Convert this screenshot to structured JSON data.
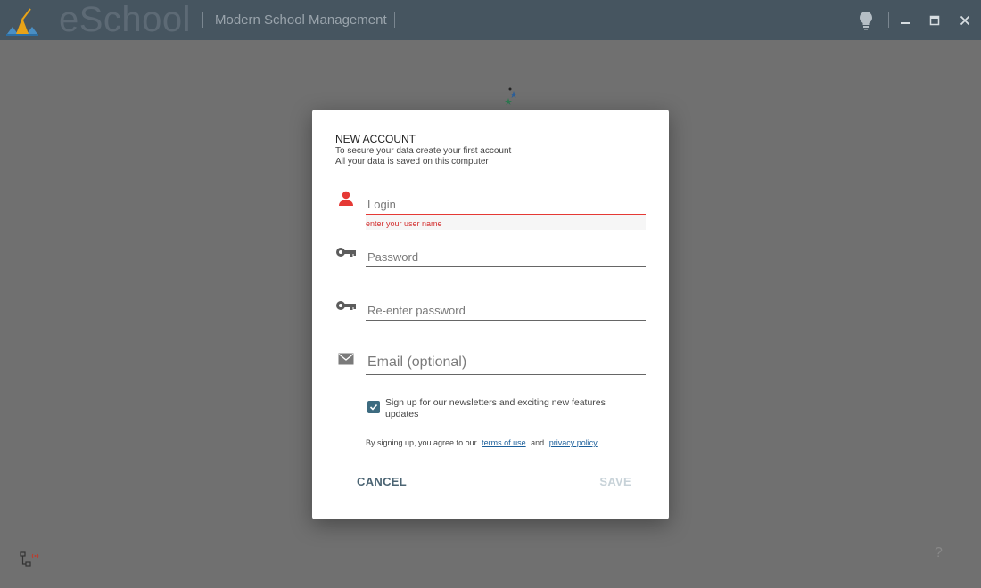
{
  "window": {
    "brand": "eSchool",
    "subtitle": "Modern School Management",
    "icons": [
      "app-logo-icon",
      "lightbulb-icon",
      "minimize-icon",
      "maximize-icon",
      "close-icon"
    ]
  },
  "dialog": {
    "title": "NEW ACCOUNT",
    "desc_line1": "To secure your data create your first account",
    "desc_line2": "All your data is saved on this computer",
    "fields": {
      "login": {
        "placeholder": "Login",
        "value": "",
        "error": "enter your user name",
        "icon": "person-icon"
      },
      "password": {
        "placeholder": "Password",
        "value": "",
        "icon": "key-icon"
      },
      "repassword": {
        "placeholder": "Re-enter password",
        "value": "",
        "icon": "key-icon"
      },
      "email": {
        "placeholder": "Email (optional)",
        "value": "",
        "icon": "mail-icon"
      }
    },
    "newsletter": {
      "label": "Sign up for our newsletters and exciting new features updates",
      "checked": true
    },
    "agree_prefix": "By signing up, you agree to our",
    "terms_link": "terms of use",
    "agree_and": "and",
    "privacy_link": "privacy policy",
    "cancel_label": "CANCEL",
    "save_label": "SAVE"
  },
  "footer": {
    "help_label": "?"
  },
  "colors": {
    "titlebar": "#465560",
    "error": "#e53935",
    "accent": "#3d6b80"
  }
}
